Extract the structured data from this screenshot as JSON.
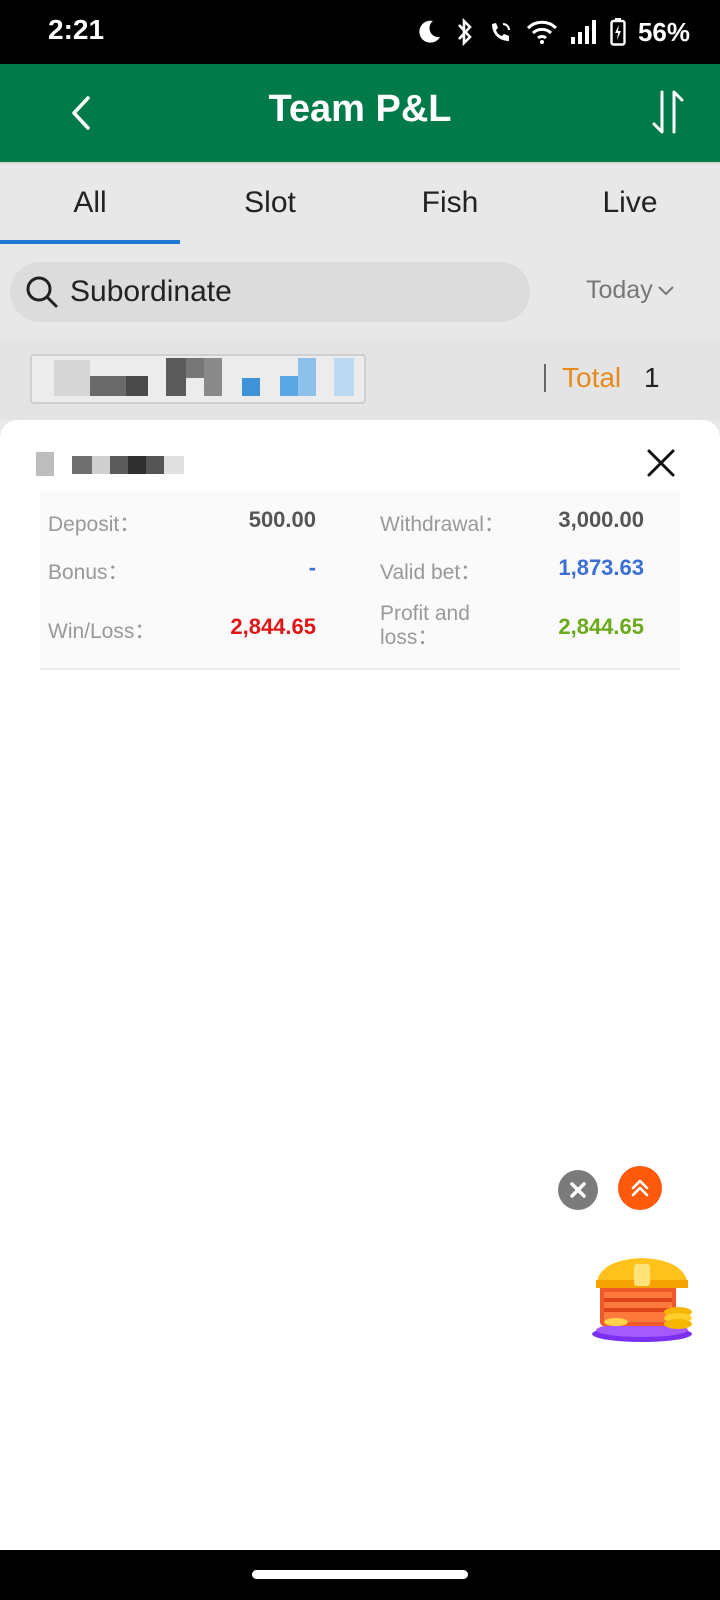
{
  "status_bar": {
    "time": "2:21",
    "battery": "56%",
    "icons": [
      "moon-icon",
      "bluetooth-icon",
      "wifi-calling-icon",
      "wifi-icon",
      "signal-icon",
      "battery-icon"
    ]
  },
  "header": {
    "title": "Team P&L",
    "background": "#007a48"
  },
  "tabs": [
    {
      "label": "All",
      "active": true
    },
    {
      "label": "Slot",
      "active": false
    },
    {
      "label": "Fish",
      "active": false
    },
    {
      "label": "Live",
      "active": false
    }
  ],
  "search": {
    "label": "Subordinate",
    "date_filter": "Today"
  },
  "summary": {
    "total_label": "Total",
    "total_count": "1"
  },
  "detail": {
    "deposit": {
      "label": "Deposit：",
      "value": "500.00"
    },
    "withdrawal": {
      "label": "Withdrawal：",
      "value": "3,000.00"
    },
    "bonus": {
      "label": "Bonus：",
      "value": "-"
    },
    "valid_bet": {
      "label": "Valid bet：",
      "value": "1,873.63"
    },
    "win_loss": {
      "label": "Win/Loss：",
      "value": "2,844.65"
    },
    "profit_loss": {
      "label": "Profit and loss：",
      "value": "2,844.65"
    }
  },
  "colors": {
    "accent_tab": "#1e78d2",
    "total_label": "#e68a1b",
    "valid_bet": "#3b6fd6",
    "win_loss": "#e01515",
    "profit_loss": "#6aaa1a"
  }
}
